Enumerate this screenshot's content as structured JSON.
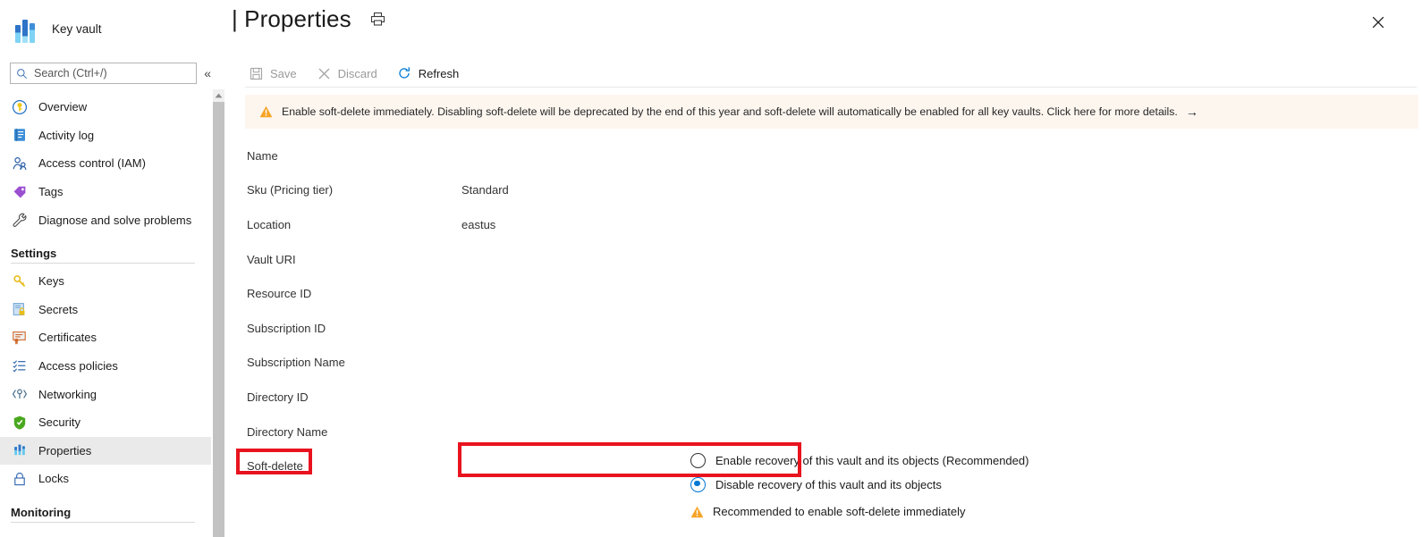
{
  "brand": {
    "icon": "key-vault-icon",
    "label": "Key vault"
  },
  "search": {
    "placeholder": "Search (Ctrl+/)",
    "icon": "search-icon",
    "collapse_icon": "«"
  },
  "sidebar": {
    "items": [
      {
        "label": "Overview",
        "icon": "overview-key-icon",
        "type": "item",
        "selected": false
      },
      {
        "label": "Activity log",
        "icon": "activity-log-icon",
        "type": "item",
        "selected": false
      },
      {
        "label": "Access control (IAM)",
        "icon": "access-control-icon",
        "type": "item",
        "selected": false
      },
      {
        "label": "Tags",
        "icon": "tags-icon",
        "type": "item",
        "selected": false
      },
      {
        "label": "Diagnose and solve problems",
        "icon": "wrench-icon",
        "type": "item",
        "selected": false
      },
      {
        "label": "Settings",
        "icon": "",
        "type": "section",
        "selected": false
      },
      {
        "label": "Keys",
        "icon": "key-icon",
        "type": "item",
        "selected": false
      },
      {
        "label": "Secrets",
        "icon": "secrets-icon",
        "type": "item",
        "selected": false
      },
      {
        "label": "Certificates",
        "icon": "certificate-icon",
        "type": "item",
        "selected": false
      },
      {
        "label": "Access policies",
        "icon": "access-policies-icon",
        "type": "item",
        "selected": false
      },
      {
        "label": "Networking",
        "icon": "networking-icon",
        "type": "item",
        "selected": false
      },
      {
        "label": "Security",
        "icon": "shield-icon",
        "type": "item",
        "selected": false
      },
      {
        "label": "Properties",
        "icon": "properties-icon",
        "type": "item",
        "selected": true
      },
      {
        "label": "Locks",
        "icon": "lock-icon",
        "type": "item",
        "selected": false
      },
      {
        "label": "Monitoring",
        "icon": "",
        "type": "section",
        "selected": false
      }
    ]
  },
  "header": {
    "title": "| Properties",
    "print_icon": "print-icon",
    "close_icon": "close-icon"
  },
  "toolbar": {
    "commands": [
      {
        "label": "Save",
        "icon": "save-icon",
        "state": "disabled"
      },
      {
        "label": "Discard",
        "icon": "discard-icon",
        "state": "disabled"
      },
      {
        "label": "Refresh",
        "icon": "refresh-icon",
        "state": "enabled"
      }
    ]
  },
  "banner": {
    "icon": "warning-icon",
    "text": "Enable soft-delete immediately. Disabling soft-delete will be deprecated by the end of this year and soft-delete will automatically be enabled for all key vaults. Click here for more details.",
    "arrow": "→",
    "background": "#fdf6ef",
    "icon_color": "#f7a325"
  },
  "properties": [
    {
      "label": "Name",
      "value": ""
    },
    {
      "label": "Sku (Pricing tier)",
      "value": "Standard"
    },
    {
      "label": "Location",
      "value": "eastus"
    },
    {
      "label": "Vault URI",
      "value": ""
    },
    {
      "label": "Resource ID",
      "value": ""
    },
    {
      "label": "Subscription ID",
      "value": ""
    },
    {
      "label": "Subscription Name",
      "value": ""
    },
    {
      "label": "Directory ID",
      "value": ""
    },
    {
      "label": "Directory Name",
      "value": ""
    },
    {
      "label": "Soft-delete",
      "value": ""
    }
  ],
  "soft_delete": {
    "options": [
      {
        "label": "Enable recovery of this vault and its objects (Recommended)",
        "checked": false
      },
      {
        "label": "Disable recovery of this vault and its objects",
        "checked": true
      }
    ],
    "recommendation": {
      "icon": "warning-icon",
      "text": "Recommended to enable soft-delete immediately"
    }
  },
  "annotations": {
    "highlight_color": "#e8131e",
    "boxes": [
      {
        "name": "soft-delete-label-highlight"
      },
      {
        "name": "enable-recovery-option-highlight"
      }
    ]
  },
  "colors": {
    "accent": "#0078d4",
    "selected_nav_bg": "#eaeaea",
    "warning": "#f7a325",
    "text": "#1b1b1b"
  }
}
